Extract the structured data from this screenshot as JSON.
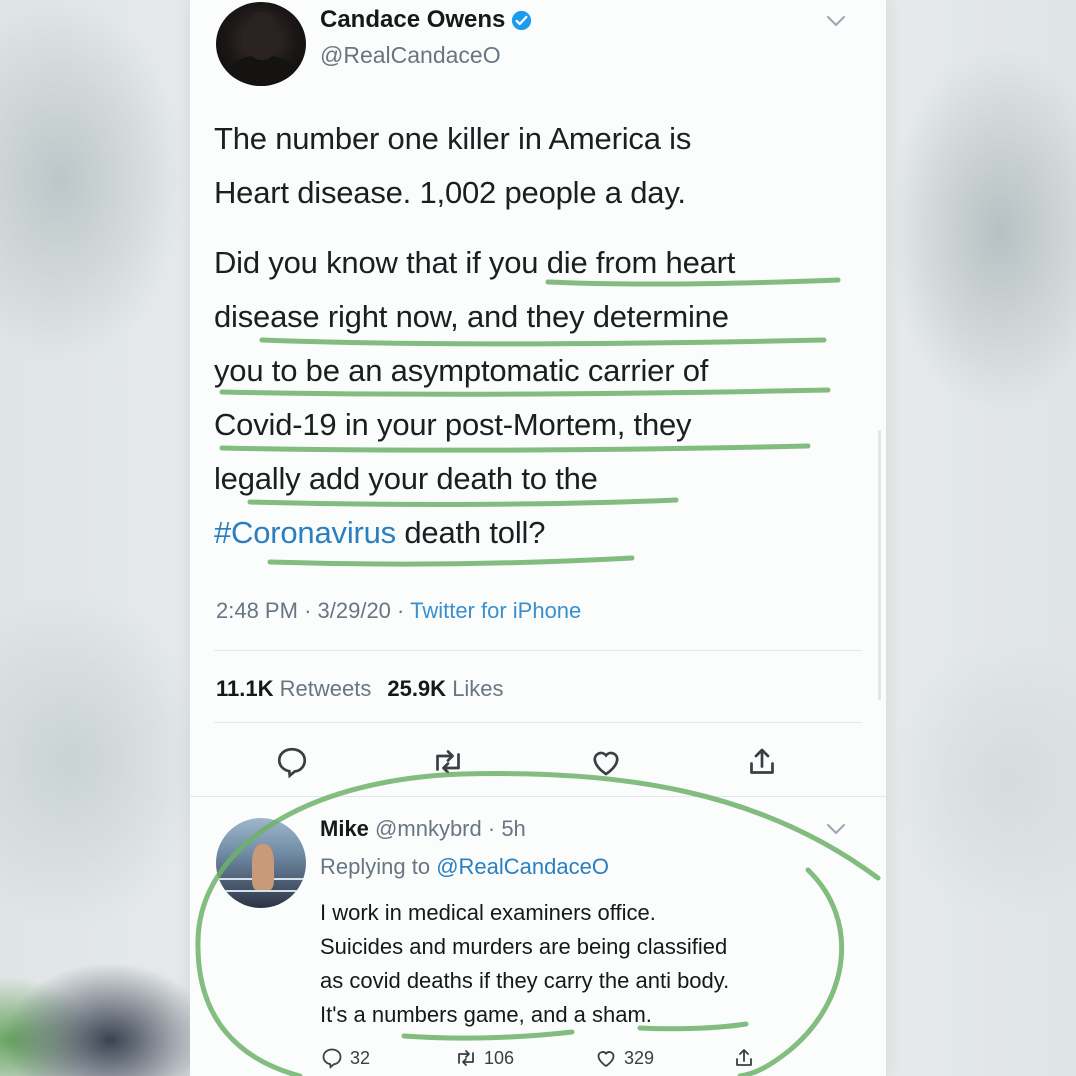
{
  "tweet": {
    "author_name": "Candace Owens",
    "author_handle": "@RealCandaceO",
    "body_lines_p1": [
      "The number one killer in America is",
      "Heart disease. 1,002 people a day."
    ],
    "body_lines_p2": [
      "Did you know that if you die from heart",
      "disease right now, and they determine",
      "you to be an asymptomatic carrier of",
      "Covid-19 in your post-Mortem, they",
      "legally add your death to the"
    ],
    "hashtag": "#Coronavirus",
    "body_last_tail": " death toll?",
    "time": "2:48 PM",
    "date": "3/29/20",
    "source": "Twitter for iPhone",
    "retweets_count": "11.1K",
    "retweets_label": "Retweets",
    "likes_count": "25.9K",
    "likes_label": "Likes"
  },
  "reply": {
    "author_name": "Mike",
    "author_handle": "@mnkybrd",
    "age": "5h",
    "replying_prefix": "Replying to",
    "replying_to": "@RealCandaceO",
    "body_lines": [
      "I work in medical examiners office.",
      "Suicides and murders are being classified",
      "as covid deaths if they carry the anti body.",
      "It's a numbers game, and a sham."
    ],
    "reply_count": "32",
    "retweet_count": "106",
    "like_count": "329"
  },
  "colors": {
    "accent_blue": "#2a7fc0",
    "highlight_green": "#6db26a",
    "muted_text": "#697682"
  },
  "icons": [
    "verified-badge-icon",
    "chevron-down-icon",
    "reply-icon",
    "retweet-icon",
    "like-icon",
    "share-icon"
  ]
}
